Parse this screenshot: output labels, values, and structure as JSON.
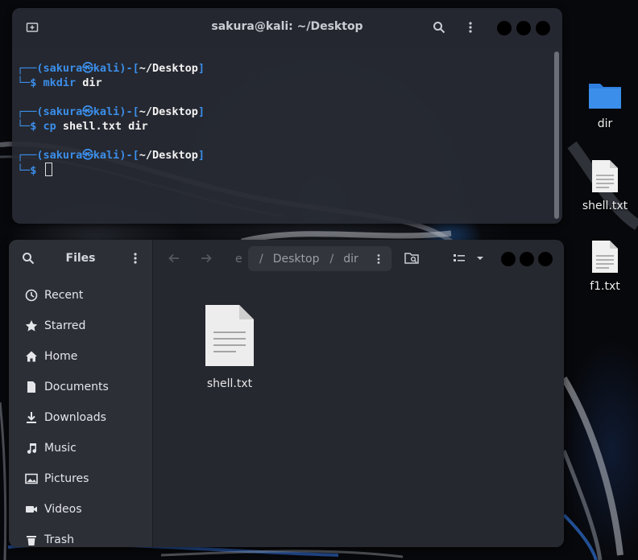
{
  "desktop": {
    "icons": [
      {
        "label": "dir",
        "icon": "folder-icon"
      },
      {
        "label": "shell.txt",
        "icon": "text-file-icon"
      },
      {
        "label": "f1.txt",
        "icon": "text-file-icon"
      }
    ]
  },
  "terminal": {
    "title": "sakura@kali: ~/Desktop",
    "prompts": [
      {
        "open": "┌──(",
        "user": "sakura",
        "at": "㉿",
        "host": "kali",
        "mid": ")-[",
        "path": "~/Desktop",
        "close": "]",
        "lead": "└─$ ",
        "cmd": "mkdir",
        "args": " dir"
      },
      {
        "open": "┌──(",
        "user": "sakura",
        "at": "㉿",
        "host": "kali",
        "mid": ")-[",
        "path": "~/Desktop",
        "close": "]",
        "lead": "└─$ ",
        "cmd": "cp",
        "args": " shell.txt dir"
      },
      {
        "open": "┌──(",
        "user": "sakura",
        "at": "㉿",
        "host": "kali",
        "mid": ")-[",
        "path": "~/Desktop",
        "close": "]",
        "lead": "└─$ ",
        "cmd": "",
        "args": ""
      }
    ]
  },
  "files": {
    "title": "Files",
    "sidebar": [
      {
        "label": "Recent",
        "icon": "clock-icon"
      },
      {
        "label": "Starred",
        "icon": "star-icon"
      },
      {
        "label": "Home",
        "icon": "home-icon"
      },
      {
        "label": "Documents",
        "icon": "document-icon"
      },
      {
        "label": "Downloads",
        "icon": "download-icon"
      },
      {
        "label": "Music",
        "icon": "music-icon"
      },
      {
        "label": "Pictures",
        "icon": "picture-icon"
      },
      {
        "label": "Videos",
        "icon": "video-icon"
      },
      {
        "label": "Trash",
        "icon": "trash-icon"
      }
    ],
    "path": {
      "truncated": "e",
      "sep1": "/",
      "seg1": "Desktop",
      "sep2": "/",
      "seg2": "dir"
    },
    "content": [
      {
        "label": "shell.txt",
        "icon": "text-file-icon"
      }
    ]
  },
  "colors": {
    "accent": "#3b8eea",
    "folder": "#2f7fe0",
    "window": "#262830"
  }
}
